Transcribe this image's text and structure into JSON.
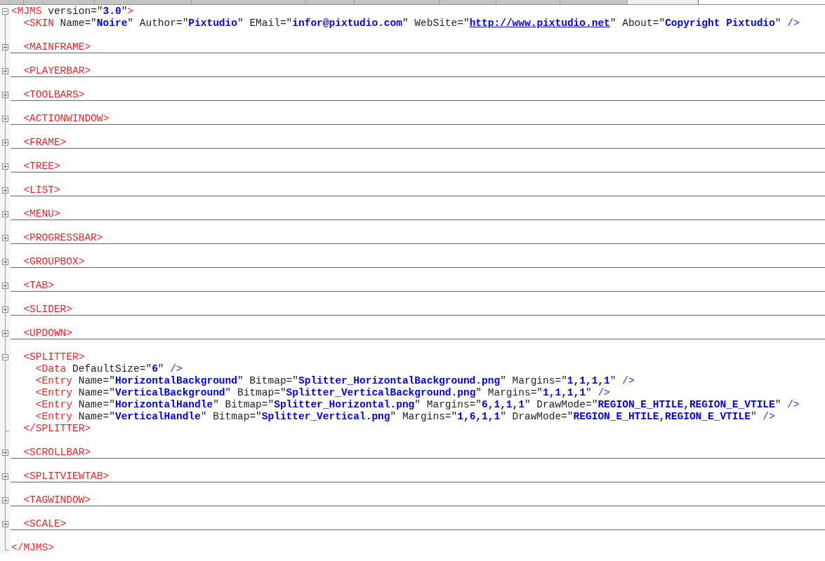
{
  "document": {
    "kind": "element",
    "expanded": true,
    "open": [
      {
        "kind": "tag",
        "text": "<MJMS"
      },
      {
        "kind": "attr",
        "text": " version=\""
      },
      {
        "kind": "value",
        "text": "3.0"
      },
      {
        "kind": "attr",
        "text": "\""
      },
      {
        "kind": "tag",
        "text": ">"
      }
    ],
    "children": [
      {
        "kind": "leaf",
        "open": [
          {
            "kind": "tag",
            "text": "<SKIN"
          },
          {
            "kind": "attr",
            "text": " Name=\""
          },
          {
            "kind": "value",
            "text": "Noire"
          },
          {
            "kind": "attr",
            "text": "\" Author=\""
          },
          {
            "kind": "value",
            "text": "Pixtudio"
          },
          {
            "kind": "attr",
            "text": "\" EMail=\""
          },
          {
            "kind": "value",
            "text": "infor@pixtudio.com"
          },
          {
            "kind": "attr",
            "text": "\" WebSite=\""
          },
          {
            "kind": "link",
            "text": "http://www.pixtudio.net"
          },
          {
            "kind": "attr",
            "text": "\" About=\""
          },
          {
            "kind": "value",
            "text": "Copyright Pixtudio"
          },
          {
            "kind": "attr",
            "text": "\" "
          },
          {
            "kind": "slash",
            "text": "/>"
          }
        ]
      },
      {
        "kind": "element",
        "expanded": false,
        "open": [
          {
            "kind": "tag",
            "text": "<MAINFRAME>"
          }
        ]
      },
      {
        "kind": "element",
        "expanded": false,
        "open": [
          {
            "kind": "tag",
            "text": "<PLAYERBAR>"
          }
        ]
      },
      {
        "kind": "element",
        "expanded": false,
        "open": [
          {
            "kind": "tag",
            "text": "<TOOLBARS>"
          }
        ]
      },
      {
        "kind": "element",
        "expanded": false,
        "open": [
          {
            "kind": "tag",
            "text": "<ACTIONWINDOW>"
          }
        ]
      },
      {
        "kind": "element",
        "expanded": false,
        "open": [
          {
            "kind": "tag",
            "text": "<FRAME>"
          }
        ]
      },
      {
        "kind": "element",
        "expanded": false,
        "open": [
          {
            "kind": "tag",
            "text": "<TREE>"
          }
        ]
      },
      {
        "kind": "element",
        "expanded": false,
        "open": [
          {
            "kind": "tag",
            "text": "<LIST>"
          }
        ]
      },
      {
        "kind": "element",
        "expanded": false,
        "open": [
          {
            "kind": "tag",
            "text": "<MENU>"
          }
        ]
      },
      {
        "kind": "element",
        "expanded": false,
        "open": [
          {
            "kind": "tag",
            "text": "<PROGRESSBAR>"
          }
        ]
      },
      {
        "kind": "element",
        "expanded": false,
        "open": [
          {
            "kind": "tag",
            "text": "<GROUPBOX>"
          }
        ]
      },
      {
        "kind": "element",
        "expanded": false,
        "open": [
          {
            "kind": "tag",
            "text": "<TAB>"
          }
        ]
      },
      {
        "kind": "element",
        "expanded": false,
        "open": [
          {
            "kind": "tag",
            "text": "<SLIDER>"
          }
        ]
      },
      {
        "kind": "element",
        "expanded": false,
        "open": [
          {
            "kind": "tag",
            "text": "<UPDOWN>"
          }
        ]
      },
      {
        "kind": "element",
        "expanded": true,
        "open": [
          {
            "kind": "tag",
            "text": "<SPLITTER>"
          }
        ],
        "children": [
          {
            "kind": "leaf",
            "open": [
              {
                "kind": "tag",
                "text": "<Data"
              },
              {
                "kind": "attr",
                "text": " DefaultSize=\""
              },
              {
                "kind": "value",
                "text": "6"
              },
              {
                "kind": "attr",
                "text": "\" "
              },
              {
                "kind": "slash",
                "text": "/>"
              }
            ]
          },
          {
            "kind": "leaf",
            "open": [
              {
                "kind": "tag",
                "text": "<Entry"
              },
              {
                "kind": "attr",
                "text": " Name=\""
              },
              {
                "kind": "value",
                "text": "HorizontalBackground"
              },
              {
                "kind": "attr",
                "text": "\" Bitmap=\""
              },
              {
                "kind": "value",
                "text": "Splitter_HorizontalBackground.png"
              },
              {
                "kind": "attr",
                "text": "\" Margins=\""
              },
              {
                "kind": "value",
                "text": "1,1,1,1"
              },
              {
                "kind": "attr",
                "text": "\" "
              },
              {
                "kind": "slash",
                "text": "/>"
              }
            ]
          },
          {
            "kind": "leaf",
            "open": [
              {
                "kind": "tag",
                "text": "<Entry"
              },
              {
                "kind": "attr",
                "text": " Name=\""
              },
              {
                "kind": "value",
                "text": "VerticalBackground"
              },
              {
                "kind": "attr",
                "text": "\" Bitmap=\""
              },
              {
                "kind": "value",
                "text": "Splitter_VerticalBackground.png"
              },
              {
                "kind": "attr",
                "text": "\" Margins=\""
              },
              {
                "kind": "value",
                "text": "1,1,1,1"
              },
              {
                "kind": "attr",
                "text": "\" "
              },
              {
                "kind": "slash",
                "text": "/>"
              }
            ]
          },
          {
            "kind": "leaf",
            "open": [
              {
                "kind": "tag",
                "text": "<Entry"
              },
              {
                "kind": "attr",
                "text": " Name=\""
              },
              {
                "kind": "value",
                "text": "HorizontalHandle"
              },
              {
                "kind": "attr",
                "text": "\" Bitmap=\""
              },
              {
                "kind": "value",
                "text": "Splitter_Horizontal.png"
              },
              {
                "kind": "attr",
                "text": "\" Margins=\""
              },
              {
                "kind": "value",
                "text": "6,1,1,1"
              },
              {
                "kind": "attr",
                "text": "\" DrawMode=\""
              },
              {
                "kind": "value",
                "text": "REGION_E_HTILE,REGION_E_VTILE"
              },
              {
                "kind": "attr",
                "text": "\" "
              },
              {
                "kind": "slash",
                "text": "/>"
              }
            ]
          },
          {
            "kind": "leaf",
            "open": [
              {
                "kind": "tag",
                "text": "<Entry"
              },
              {
                "kind": "attr",
                "text": " Name=\""
              },
              {
                "kind": "value",
                "text": "VerticalHandle"
              },
              {
                "kind": "attr",
                "text": "\" Bitmap=\""
              },
              {
                "kind": "value",
                "text": "Splitter_Vertical.png"
              },
              {
                "kind": "attr",
                "text": "\" Margins=\""
              },
              {
                "kind": "value",
                "text": "1,6,1,1"
              },
              {
                "kind": "attr",
                "text": "\" DrawMode=\""
              },
              {
                "kind": "value",
                "text": "REGION_E_HTILE,REGION_E_VTILE"
              },
              {
                "kind": "attr",
                "text": "\" "
              },
              {
                "kind": "slash",
                "text": "/>"
              }
            ]
          }
        ],
        "close": [
          {
            "kind": "tag",
            "text": "</SPLITTER>"
          }
        ]
      },
      {
        "kind": "element",
        "expanded": false,
        "open": [
          {
            "kind": "tag",
            "text": "<SCROLLBAR>"
          }
        ]
      },
      {
        "kind": "element",
        "expanded": false,
        "open": [
          {
            "kind": "tag",
            "text": "<SPLITVIEWTAB>"
          }
        ]
      },
      {
        "kind": "element",
        "expanded": false,
        "open": [
          {
            "kind": "tag",
            "text": "<TAGWINDOW>"
          }
        ]
      },
      {
        "kind": "element",
        "expanded": false,
        "open": [
          {
            "kind": "tag",
            "text": "<SCALE>"
          }
        ]
      }
    ],
    "close": [
      {
        "kind": "tag",
        "text": "</MJMS>"
      }
    ]
  }
}
